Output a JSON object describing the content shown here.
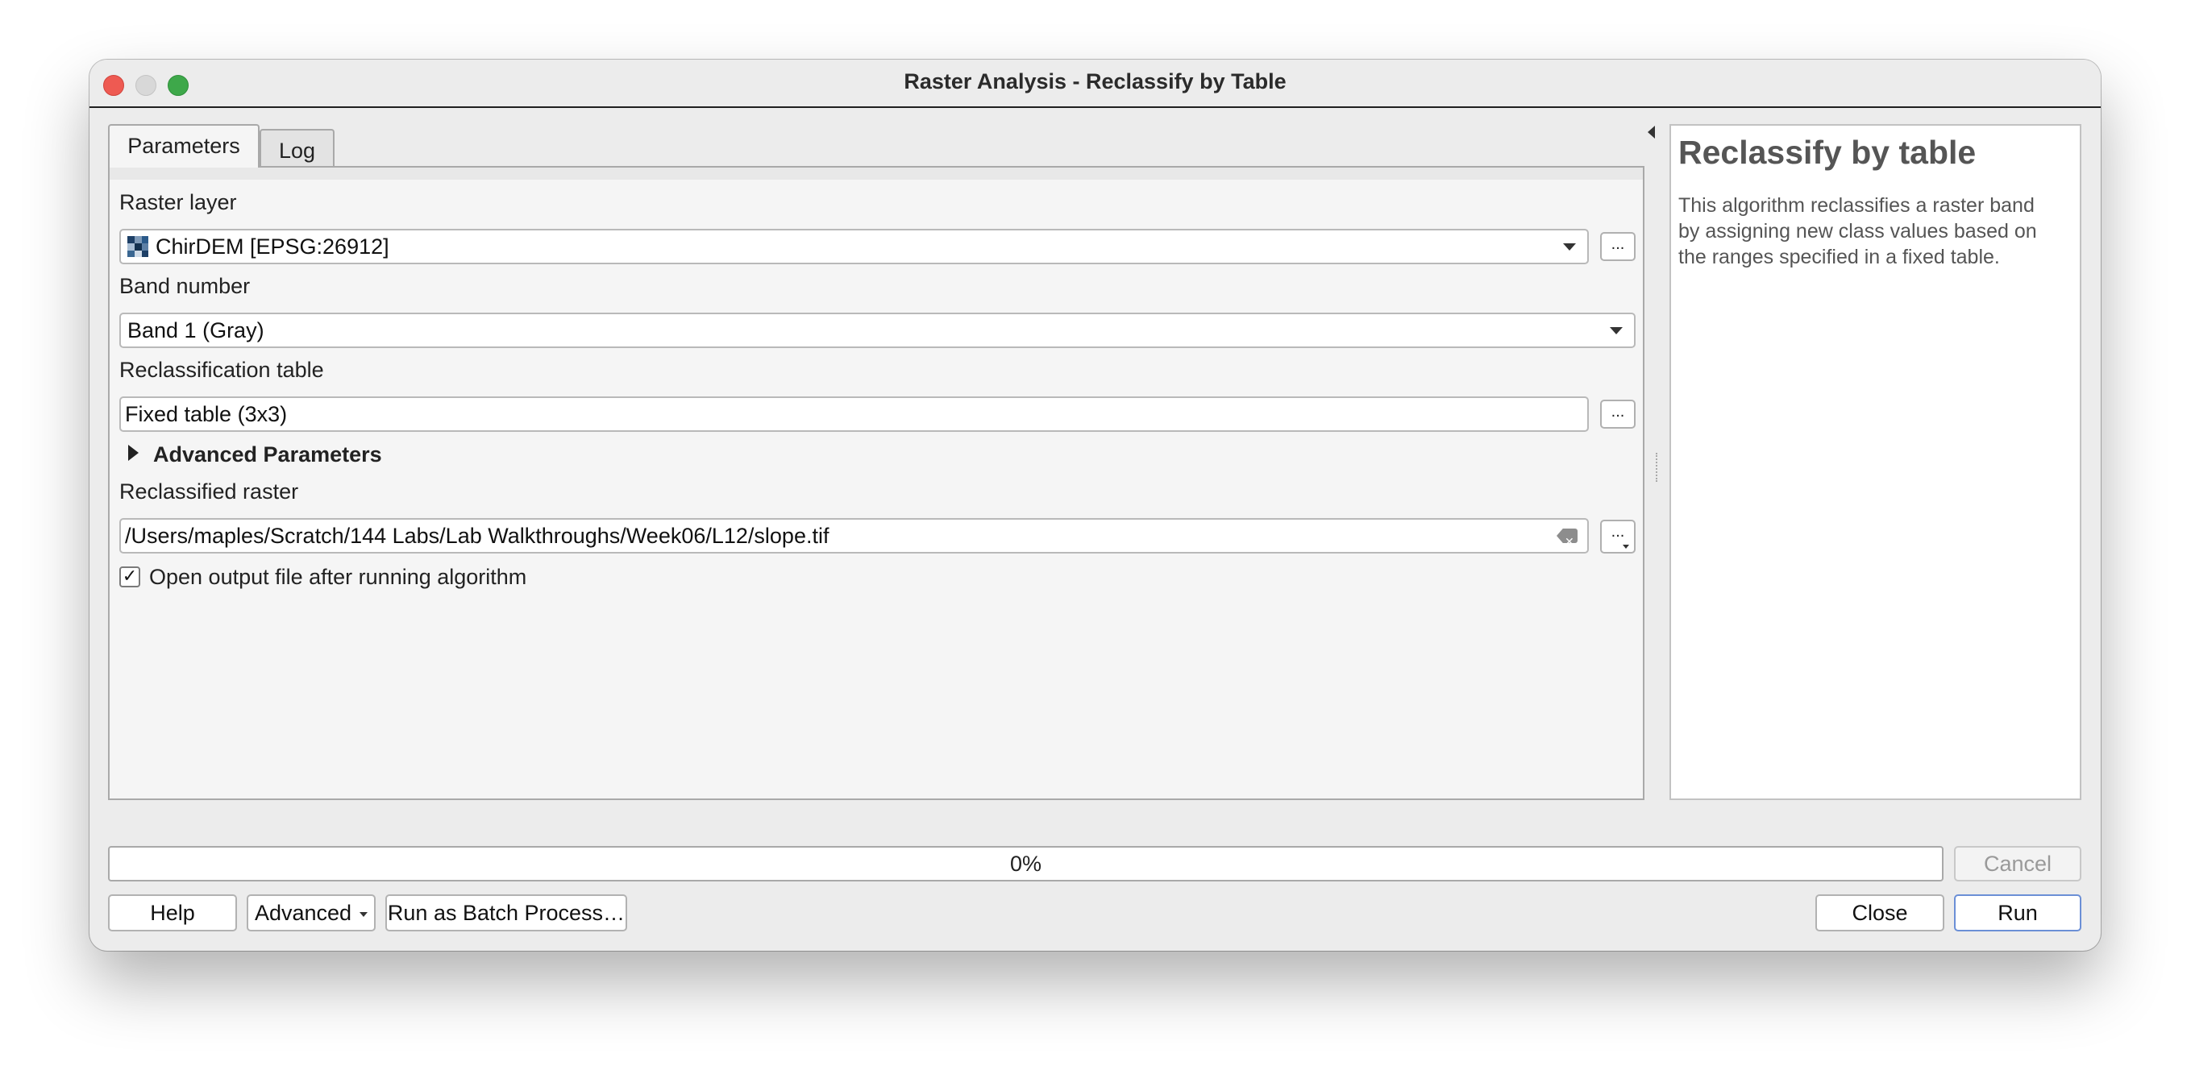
{
  "window": {
    "title": "Raster Analysis - Reclassify by Table"
  },
  "tabs": [
    {
      "label": "Parameters"
    },
    {
      "label": "Log"
    }
  ],
  "params": {
    "raster_layer_label": "Raster layer",
    "raster_layer_value": "ChirDEM [EPSG:26912]",
    "band_label": "Band number",
    "band_value": "Band 1 (Gray)",
    "reclass_table_label": "Reclassification table",
    "reclass_table_value": "Fixed table (3x3)",
    "advanced_label": "Advanced Parameters",
    "output_label": "Reclassified raster",
    "output_value": "/Users/maples/Scratch/144 Labs/Lab Walkthroughs/Week06/L12/slope.tif",
    "open_output_label": "Open output file after running algorithm",
    "open_output_checked": true,
    "checkmark": "✓",
    "browse_label": "..."
  },
  "help": {
    "title": "Reclassify by table",
    "body": "This algorithm reclassifies a raster band by assigning new class values based on the ranges specified in a fixed table."
  },
  "progress": {
    "text": "0%",
    "value": 0
  },
  "buttons": {
    "cancel": "Cancel",
    "help": "Help",
    "advanced": "Advanced",
    "batch": "Run as Batch Process…",
    "close": "Close",
    "run": "Run"
  }
}
